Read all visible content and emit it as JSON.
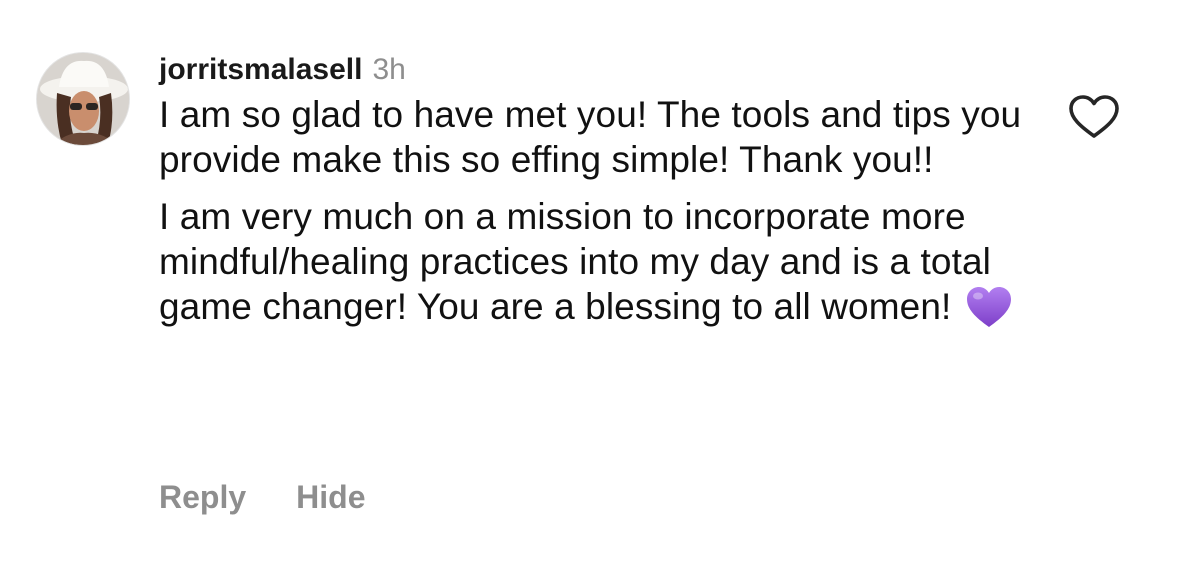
{
  "comment": {
    "username": "jorritsmalasell",
    "timestamp": "3h",
    "paragraphs": [
      "I am so glad to have met you! The tools and tips you provide make this so effing simple! Thank you!!",
      "I am very much on a mission to incorporate more mindful/healing practices into my day and is a total game changer! You are a blessing to all women!"
    ],
    "emoji": "purple-heart-emoji",
    "actions": {
      "reply_label": "Reply",
      "hide_label": "Hide"
    },
    "like_icon": "heart-outline-icon"
  },
  "colors": {
    "text": "#111111",
    "secondary": "#8e8e8e",
    "emoji_purple": "#9b59d6"
  }
}
